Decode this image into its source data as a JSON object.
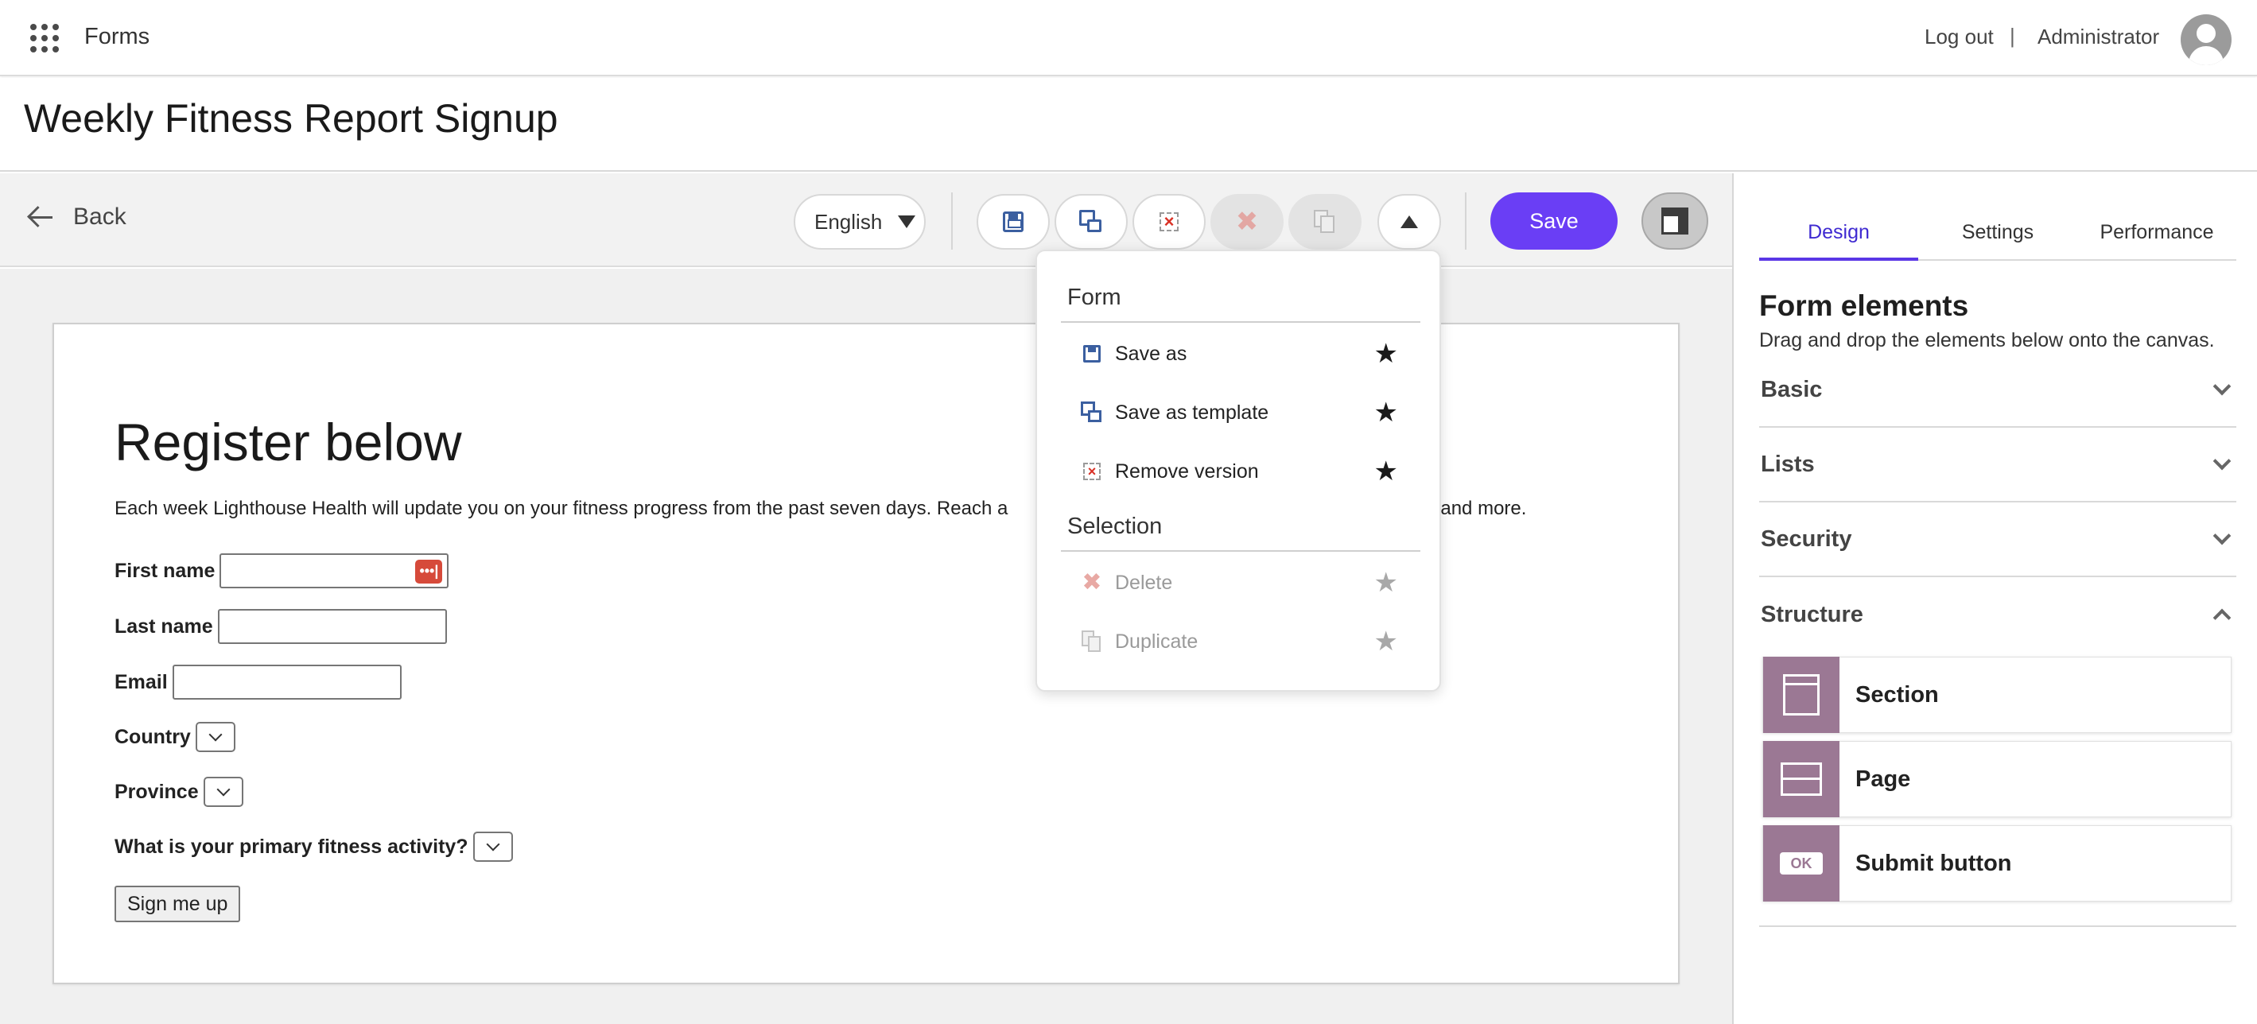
{
  "topbar": {
    "app_name": "Forms",
    "logout_label": "Log out",
    "separator": "|",
    "user_name": "Administrator"
  },
  "page_title": "Weekly Fitness Report Signup",
  "toolbar": {
    "back_label": "Back",
    "language": "English",
    "save_label": "Save"
  },
  "form": {
    "heading": "Register below",
    "description": "Each week Lighthouse Health will update you on your fitness progress from the past seven days. Reach a",
    "description_tail": "ng and more.",
    "fields": {
      "first_name": "First name",
      "last_name": "Last name",
      "email": "Email",
      "country": "Country",
      "province": "Province",
      "activity": "What is your primary fitness activity?"
    },
    "password_badge": "•••|",
    "submit_label": "Sign me up"
  },
  "menu": {
    "form_section": "Form",
    "selection_section": "Selection",
    "items": {
      "save_as": "Save as",
      "save_as_template": "Save as template",
      "remove_version": "Remove version",
      "delete": "Delete",
      "duplicate": "Duplicate"
    },
    "star": "★"
  },
  "panel": {
    "tabs": [
      "Design",
      "Settings",
      "Performance"
    ],
    "title": "Form elements",
    "subtitle": "Drag and drop the elements below onto the canvas.",
    "categories": [
      "Basic",
      "Lists",
      "Security",
      "Structure"
    ],
    "structure_elements": [
      {
        "label": "Section",
        "icon": "section-icon"
      },
      {
        "label": "Page",
        "icon": "page-icon"
      },
      {
        "label": "Submit button",
        "icon": "submit-button-icon",
        "icon_text": "OK"
      }
    ]
  },
  "colors": {
    "accent": "#6a3ef5",
    "element_icon_bg": "#9b7894",
    "tab_active": "#3f2ad1"
  }
}
